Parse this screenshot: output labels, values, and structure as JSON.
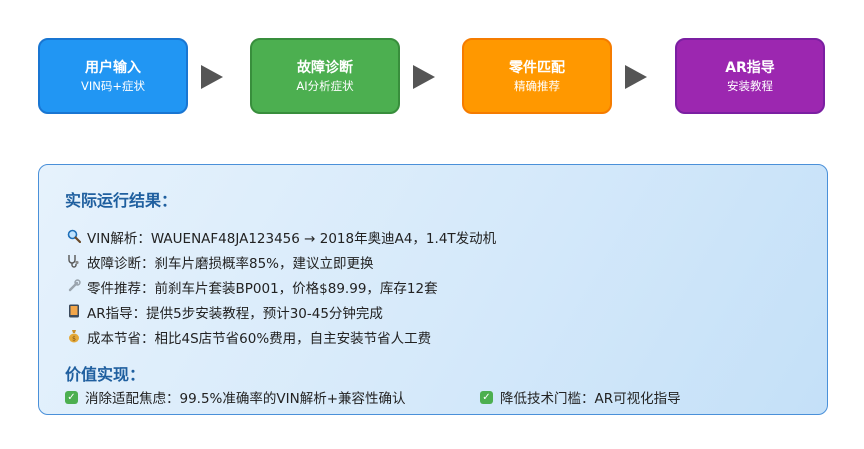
{
  "flow": {
    "steps": [
      {
        "title": "用户输入",
        "subtitle": "VIN码+症状",
        "color": "#2196f3",
        "border": "#1976d2"
      },
      {
        "title": "故障诊断",
        "subtitle": "AI分析症状",
        "color": "#4caf50",
        "border": "#388e3c"
      },
      {
        "title": "零件匹配",
        "subtitle": "精确推荐",
        "color": "#ff9800",
        "border": "#f57c00"
      },
      {
        "title": "AR指导",
        "subtitle": "安装教程",
        "color": "#9c27b0",
        "border": "#7b1fa2"
      }
    ],
    "arrow_color": "#555555"
  },
  "results": {
    "title": "实际运行结果：",
    "items": [
      {
        "icon": "magnifier-icon",
        "text": "VIN解析：WAUENAF48JA123456 → 2018年奥迪A4，1.4T发动机"
      },
      {
        "icon": "stethoscope-icon",
        "text": "故障诊断：刹车片磨损概率85%，建议立即更换"
      },
      {
        "icon": "wrench-icon",
        "text": "零件推荐：前刹车片套装BP001，价格$89.99，库存12套"
      },
      {
        "icon": "phone-icon",
        "text": "AR指导：提供5步安装教程，预计30-45分钟完成"
      },
      {
        "icon": "money-bag-icon",
        "text": "成本节省：相比4S店节省60%费用，自主安装节省人工费"
      }
    ]
  },
  "value": {
    "title": "价值实现：",
    "items": [
      "消除适配焦虑：99.5%准确率的VIN解析+兼容性确认",
      "降低技术门槛：AR可视化指导"
    ]
  }
}
